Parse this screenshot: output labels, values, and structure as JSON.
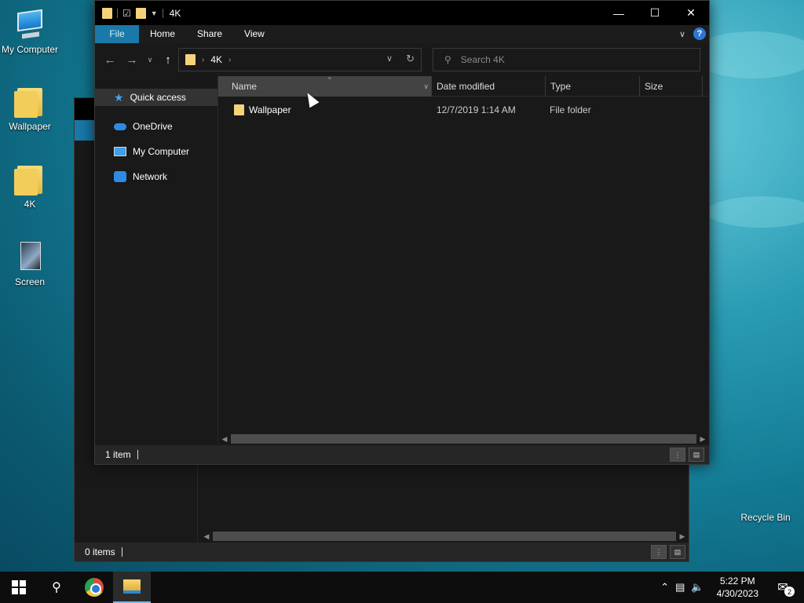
{
  "desktop": {
    "icons": [
      {
        "label": "My Computer",
        "icon": "computer-icon"
      },
      {
        "label": "Wallpaper",
        "icon": "folder-icon"
      },
      {
        "label": "4K",
        "icon": "folder-icon"
      },
      {
        "label": "Screen",
        "icon": "image-folder-icon"
      }
    ],
    "recycle_bin_label": "Recycle Bin"
  },
  "back_window": {
    "status_text": "0 items"
  },
  "explorer": {
    "title": "4K",
    "ribbon": {
      "file": "File",
      "home": "Home",
      "share": "Share",
      "view": "View",
      "help_symbol": "?"
    },
    "address": {
      "crumb": "4K"
    },
    "search": {
      "placeholder": "Search 4K"
    },
    "nav_pane": {
      "items": [
        {
          "label": "Quick access",
          "icon": "star-icon"
        },
        {
          "label": "OneDrive",
          "icon": "cloud-icon"
        },
        {
          "label": "My Computer",
          "icon": "computer-icon"
        },
        {
          "label": "Network",
          "icon": "network-icon"
        }
      ]
    },
    "columns": {
      "name": "Name",
      "date": "Date modified",
      "type": "Type",
      "size": "Size"
    },
    "rows": [
      {
        "name": "Wallpaper",
        "date": "12/7/2019 1:14 AM",
        "type": "File folder",
        "size": ""
      }
    ],
    "status_text": "1 item"
  },
  "taskbar": {
    "time": "5:22 PM",
    "date": "4/30/2023",
    "notification_count": "2"
  },
  "colors": {
    "accent": "#1979a9",
    "window_bg": "#191919",
    "taskbar_bg": "#0d0d0d"
  }
}
